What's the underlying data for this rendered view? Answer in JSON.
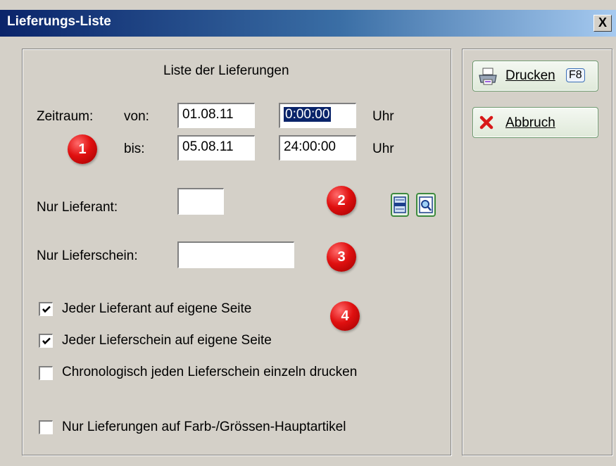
{
  "window": {
    "title": "Lieferungs-Liste",
    "close_label": "X"
  },
  "group": {
    "heading": "Liste der Lieferungen"
  },
  "period": {
    "label": "Zeitraum:",
    "from_label": "von:",
    "to_label": "bis:",
    "from_date": "01.08.11",
    "from_time": "0:00:00",
    "to_date": "05.08.11",
    "to_time": "24:00:00",
    "unit": "Uhr"
  },
  "supplier": {
    "label": "Nur Lieferant:",
    "value": ""
  },
  "delivery_note": {
    "label": "Nur Lieferschein:",
    "value": ""
  },
  "options": [
    {
      "label": "Jeder Lieferant auf eigene Seite",
      "checked": true
    },
    {
      "label": "Jeder Lieferschein auf eigene Seite",
      "checked": true
    },
    {
      "label": "Chronologisch jeden Lieferschein einzeln drucken",
      "checked": false
    },
    {
      "label": "Nur Lieferungen auf Farb-/Grössen-Hauptartikel",
      "checked": false
    }
  ],
  "badges": [
    "1",
    "2",
    "3",
    "4"
  ],
  "buttons": {
    "print": {
      "label": "Drucken",
      "shortcut": "F8",
      "icon": "printer-icon"
    },
    "cancel": {
      "label": "Abbruch",
      "icon": "red-x-icon"
    }
  },
  "colors": {
    "titlebar": "#0a246a",
    "face": "#d4d0c8",
    "selection": "#0a246a",
    "badge": "#e01010"
  }
}
